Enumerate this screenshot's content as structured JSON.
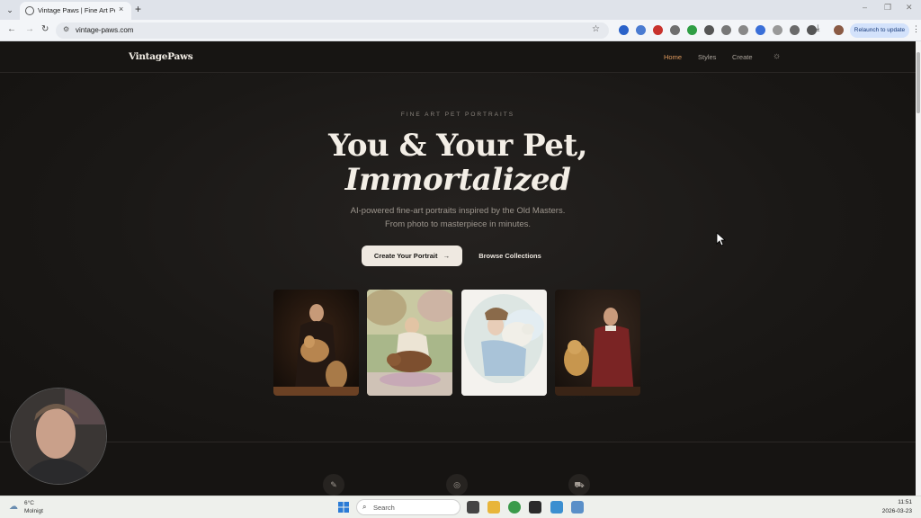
{
  "browser": {
    "tab_title": "Vintage Paws | Fine Art Pet Portraits",
    "tab_close": "×",
    "new_tab": "+",
    "url": "vintage-paws.com",
    "relaunch_label": "Relaunch to update",
    "window_controls": [
      "–",
      "❐",
      "✕"
    ],
    "nav": {
      "back": "←",
      "forward": "→",
      "reload": "↻"
    },
    "extensions": [
      {
        "name": "vpn-extension-icon",
        "color": "#2a62c9"
      },
      {
        "name": "puzzle-blue-extension-icon",
        "color": "#4a7bd1"
      },
      {
        "name": "red-circle-extension-icon",
        "color": "#c8322c"
      },
      {
        "name": "camera-extension-icon",
        "color": "#6e6e6e"
      },
      {
        "name": "green-download-extension-icon",
        "color": "#2f9e44"
      },
      {
        "name": "x-extension-icon",
        "color": "#555555"
      },
      {
        "name": "chat-extension-icon",
        "color": "#777777"
      },
      {
        "name": "gray-circle-extension-icon",
        "color": "#888888"
      },
      {
        "name": "translate-extension-icon",
        "color": "#3a6fd8"
      },
      {
        "name": "shield-extension-icon",
        "color": "#999999"
      },
      {
        "name": "color-extension-icon",
        "color": "#6a6a6a"
      },
      {
        "name": "extensions-puzzle-icon",
        "color": "#555555"
      }
    ]
  },
  "site": {
    "logo": "VintagePaws",
    "nav": {
      "home": "Home",
      "styles": "Styles",
      "create": "Create"
    },
    "theme_toggle": "☼",
    "hero": {
      "eyebrow": "FINE ART PET PORTRAITS",
      "headline_line1": "You & Your Pet,",
      "headline_line2": "Immortalized",
      "subtext": "AI-powered fine-art portraits inspired by the Old Masters. From photo to masterpiece in minutes.",
      "cta_primary": "Create Your Portrait",
      "cta_primary_arrow": "→",
      "cta_secondary": "Browse Collections"
    },
    "features": [
      {
        "icon": "wand-icon",
        "glyph": "✎"
      },
      {
        "icon": "palette-icon",
        "glyph": "◎"
      },
      {
        "icon": "truck-icon",
        "glyph": "⛟"
      }
    ]
  },
  "taskbar": {
    "weather_temp": "6°C",
    "weather_desc": "Molnigt",
    "search_placeholder": "Search",
    "time": "11:51",
    "date": "2026-03-23"
  },
  "colors": {
    "accent": "#e09a5e",
    "background": "#161412",
    "headline": "#f3eee6"
  }
}
